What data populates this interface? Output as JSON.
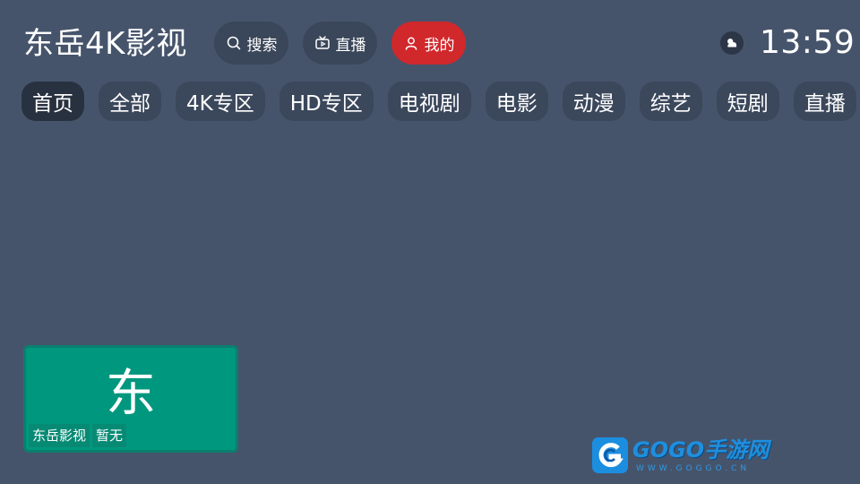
{
  "header": {
    "app_title": "东岳4K影视",
    "buttons": [
      {
        "label": "搜索",
        "icon": "search-icon"
      },
      {
        "label": "直播",
        "icon": "tv-icon"
      },
      {
        "label": "我的",
        "icon": "user-icon",
        "active": true
      }
    ],
    "weather_icon": "weather-cloud-icon",
    "clock": "13:59"
  },
  "tabs": [
    {
      "label": "首页",
      "active": true
    },
    {
      "label": "全部"
    },
    {
      "label": "4K专区"
    },
    {
      "label": "HD专区"
    },
    {
      "label": "电视剧"
    },
    {
      "label": "电影"
    },
    {
      "label": "动漫"
    },
    {
      "label": "综艺"
    },
    {
      "label": "短剧"
    },
    {
      "label": "直播"
    }
  ],
  "card": {
    "glyph": "东",
    "title": "东岳影视",
    "status": "暂无"
  },
  "watermark": {
    "brand": "GOGO手游网",
    "url": "WWW.GOGGO.CN"
  },
  "colors": {
    "background": "#46546b",
    "pill": "#3a4659",
    "accent_red": "#d1282c",
    "tab_active": "#283140",
    "card_teal": "#00977f"
  }
}
